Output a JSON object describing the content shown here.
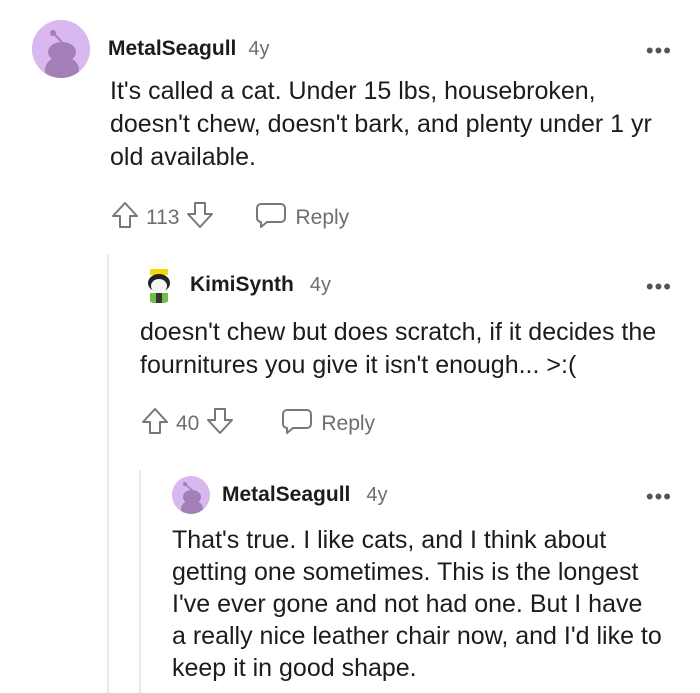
{
  "comments": [
    {
      "username": "MetalSeagull",
      "age": "4y",
      "body": "It's called a cat. Under 15 lbs, housebroken, doesn't chew, doesn't bark, and plenty under 1 yr old available.",
      "score": "113",
      "reply_label": "Reply",
      "more_label": "•••"
    },
    {
      "username": "KimiSynth",
      "age": "4y",
      "body": "doesn't chew but does scratch, if it decides the fournitures you give it isn't enough... >:(",
      "score": "40",
      "reply_label": "Reply",
      "more_label": "•••"
    },
    {
      "username": "MetalSeagull",
      "age": "4y",
      "body": "That's true. I like cats, and I think about getting one sometimes. This is the longest I've ever gone and not had one. But I have a really nice leather chair now, and I'd like to keep it in good shape.",
      "more_label": "•••"
    }
  ],
  "colors": {
    "avatar_bg": "#d9b7ef",
    "text": "#1c1c1c",
    "muted": "#6e6e6e"
  }
}
